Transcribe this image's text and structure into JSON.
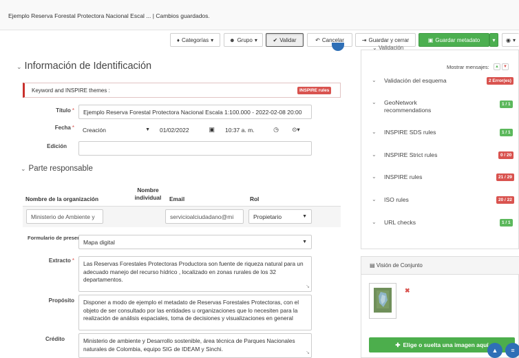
{
  "window": {
    "title": "Ejemplo Reserva Forestal Protectora Nacional Escal ... | Cambios guardados."
  },
  "toolbar": {
    "categories_label": "Categorías",
    "group_label": "Grupo",
    "validate_label": "Validar",
    "cancel_label": "Cancelar",
    "save_close_label": "Guardar y cerrar",
    "save_metadata_label": "Guardar metadato"
  },
  "identification": {
    "title": "Información de Identificación",
    "alert_text": "Keyword and INSPIRE themes :",
    "alert_badge": "INSPIRE rules",
    "titulo_label": "Título",
    "titulo_value": "Ejemplo Reserva Forestal Protectora Nacional Escala 1:100.000 - 2022-02-08 20:00",
    "fecha_label": "Fecha",
    "fecha_type": "Creación",
    "fecha_date": "01/02/2022",
    "fecha_time": "10:37 a. m.",
    "edicion_label": "Edición",
    "edicion_value": ""
  },
  "responsible": {
    "title": "Parte responsable",
    "headers": {
      "org": "Nombre de la organización",
      "individual": "Nombre individual",
      "email": "Email",
      "role": "Rol"
    },
    "row": {
      "org": "Ministerio de Ambiente y",
      "email": "servicioalciudadano@mi",
      "role": "Propietario"
    }
  },
  "presentation": {
    "form_label": "Formulario de presentación",
    "form_value": "Mapa digital",
    "extracto_label": "Extracto",
    "extracto_value": "Las Reservas Forestales Protectoras Productora son fuente de riqueza natural para un adecuado manejo del recurso hídrico , localizado en zonas rurales de los 32 departamentos.",
    "proposito_label": "Propósito",
    "proposito_value": "Disponer a modo de ejemplo el metadato de Reservas Forestales Protectoras, con el objeto de ser consultado por las entidades u organizaciones que lo necesiten para la realización de análisis espaciales, toma de decisiones y visualizaciones en general",
    "credito_label": "Crédito",
    "credito_value": "Ministerio de ambiente y Desarrollo sostenible, área técnica de Parques Nacionales naturales de Colombia, equipo SIG de IDEAM y Sinchi."
  },
  "validation": {
    "header": "Validación",
    "show_messages": "Mostrar mensajes:",
    "rows": [
      {
        "name": "Validación del esquema",
        "badge": "2 Error(es)",
        "status": "error"
      },
      {
        "name": "GeoNetwork recommendations",
        "badge": "1 / 1",
        "status": "ok"
      },
      {
        "name": "INSPIRE SDS rules",
        "badge": "1 / 1",
        "status": "ok"
      },
      {
        "name": "INSPIRE Strict rules",
        "badge": "0 / 20",
        "status": "error"
      },
      {
        "name": "INSPIRE rules",
        "badge": "21 / 29",
        "status": "error"
      },
      {
        "name": "ISO rules",
        "badge": "20 / 22",
        "status": "error"
      },
      {
        "name": "URL checks",
        "badge": "1 / 1",
        "status": "ok"
      }
    ]
  },
  "overview": {
    "title": "Visión de Conjunto",
    "choose_label": "Elige o suelta una imagen aquí"
  },
  "colors": {
    "error": "#d9534f",
    "ok": "#5cb85c",
    "primary": "#2f6fb6",
    "success": "#4cae4c"
  }
}
